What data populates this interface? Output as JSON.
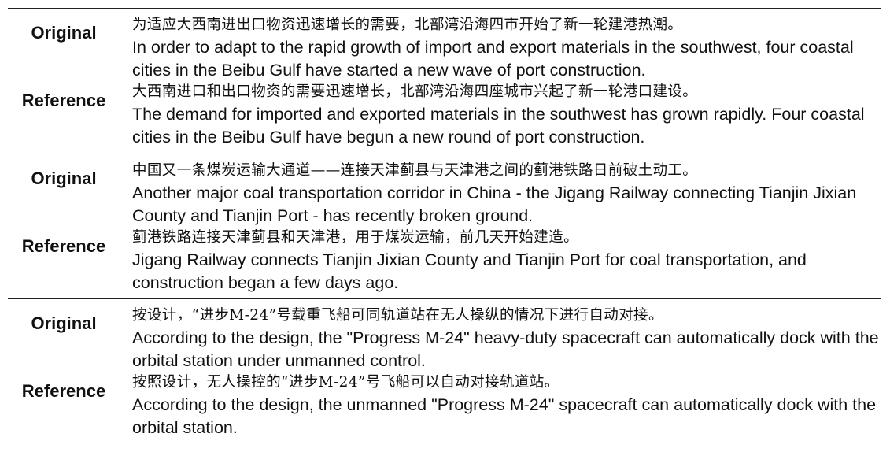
{
  "labels": {
    "original": "Original",
    "reference": "Reference"
  },
  "rows": [
    {
      "original_zh": "为适应大西南进出口物资迅速增长的需要，北部湾沿海四市开始了新一轮建港热潮。",
      "original_en": "In order to adapt to the rapid growth of import and export materials in the southwest, four coastal cities in the Beibu Gulf have started a new wave of port construction.",
      "reference_zh": "大西南进口和出口物资的需要迅速增长，北部湾沿海四座城市兴起了新一轮港口建设。",
      "reference_en": "The demand for imported and exported materials in the southwest has grown rapidly. Four coastal cities in the Beibu Gulf have begun a new round of port construction."
    },
    {
      "original_zh": "中国又一条煤炭运输大通道——连接天津蓟县与天津港之间的蓟港铁路日前破土动工。",
      "original_en": "Another major coal transportation corridor in China - the Jigang Railway connecting Tianjin Jixian County and Tianjin Port - has recently broken ground.",
      "reference_zh": "蓟港铁路连接天津蓟县和天津港，用于煤炭运输，前几天开始建造。",
      "reference_en": "Jigang Railway connects Tianjin Jixian County and Tianjin Port for coal transportation, and construction began a few days ago."
    },
    {
      "original_zh": "按设计，“进步M-24”号载重飞船可同轨道站在无人操纵的情况下进行自动对接。",
      "original_en": "According to the design, the \"Progress M-24\" heavy-duty spacecraft can automatically dock with the orbital station under unmanned control.",
      "reference_zh": "按照设计，无人操控的“进步M-24”号飞船可以自动对接轨道站。",
      "reference_en": "According to the design, the unmanned \"Progress M-24\" spacecraft can automatically dock with the orbital station."
    }
  ]
}
